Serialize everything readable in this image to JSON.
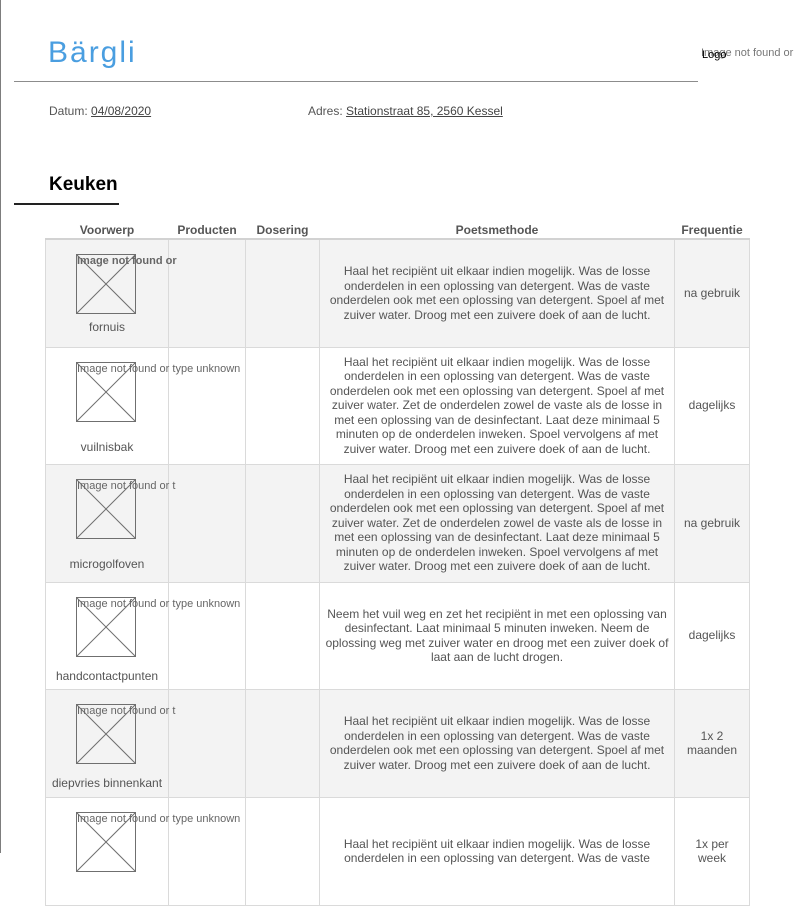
{
  "header": {
    "brand": "Bärgli",
    "logo_alt": "Logo",
    "logo_broken": "Image not found or"
  },
  "meta": {
    "date_label": "Datum:",
    "date_value": "04/08/2020",
    "address_label": "Adres:",
    "address_value": "Stationstraat 85, 2560 Kessel"
  },
  "section": {
    "title": "Keuken"
  },
  "table": {
    "columns": [
      "Voorwerp",
      "Producten",
      "Dosering",
      "Poetsmethode",
      "Frequentie"
    ],
    "rows": [
      {
        "item": "fornuis",
        "image_text": "Image not found or",
        "method": "Haal het recipiënt uit elkaar indien mogelijk. Was de losse onderdelen in een oplossing van detergent. Was de vaste onderdelen ook met een oplossing van detergent. Spoel af met zuiver water. Droog met een zuivere doek of aan de lucht.",
        "frequency": "na gebruik"
      },
      {
        "item": "vuilnisbak",
        "image_text": "Image not found or type unknown",
        "method": "Haal het recipiënt uit elkaar indien mogelijk. Was de losse onderdelen in een oplossing van detergent. Was de vaste onderdelen ook met een oplossing van detergent. Spoel af met zuiver water. Zet de onderdelen zowel de vaste als de losse in met een oplossing van de desinfectant. Laat deze minimaal 5 minuten op de onderdelen inweken. Spoel vervolgens af met zuiver water. Droog met een zuivere doek of aan de lucht.",
        "frequency": "dagelijks"
      },
      {
        "item": "microgolfoven",
        "image_text": "Image not found or t",
        "method": "Haal het recipiënt uit elkaar indien mogelijk. Was de losse onderdelen in een oplossing van detergent. Was de vaste onderdelen ook met een oplossing van detergent. Spoel af met zuiver water. Zet de onderdelen zowel de vaste als de losse in met een oplossing van de desinfectant. Laat deze minimaal 5 minuten op de onderdelen inweken. Spoel vervolgens af met zuiver water. Droog met een zuivere doek of aan de lucht.",
        "frequency": "na gebruik"
      },
      {
        "item": "handcontactpunten",
        "image_text": "Image not found or type unknown",
        "method": "Neem het vuil weg en zet het recipiënt in met een oplossing van desinfectant. Laat minimaal 5 minuten inweken. Neem de oplossing weg met zuiver water en droog met een zuiver doek of laat aan de lucht drogen.",
        "frequency": "dagelijks"
      },
      {
        "item": "diepvries binnenkant",
        "image_text": "Image not found or t",
        "method": "Haal het recipiënt uit elkaar indien mogelijk. Was de losse onderdelen in een oplossing van detergent. Was de vaste onderdelen ook met een oplossing van detergent. Spoel af met zuiver water. Droog met een zuivere doek of aan de lucht.",
        "frequency": "1x 2 maanden"
      },
      {
        "item": "",
        "image_text": "Image not found or type unknown",
        "method": "Haal het recipiënt uit elkaar indien mogelijk. Was de losse onderdelen in een oplossing van detergent. Was de vaste",
        "frequency": "1x per week"
      }
    ]
  },
  "colors": {
    "brand": "#4a9ee0",
    "row_shade": "#f3f3f3",
    "grid": "#dadada"
  }
}
